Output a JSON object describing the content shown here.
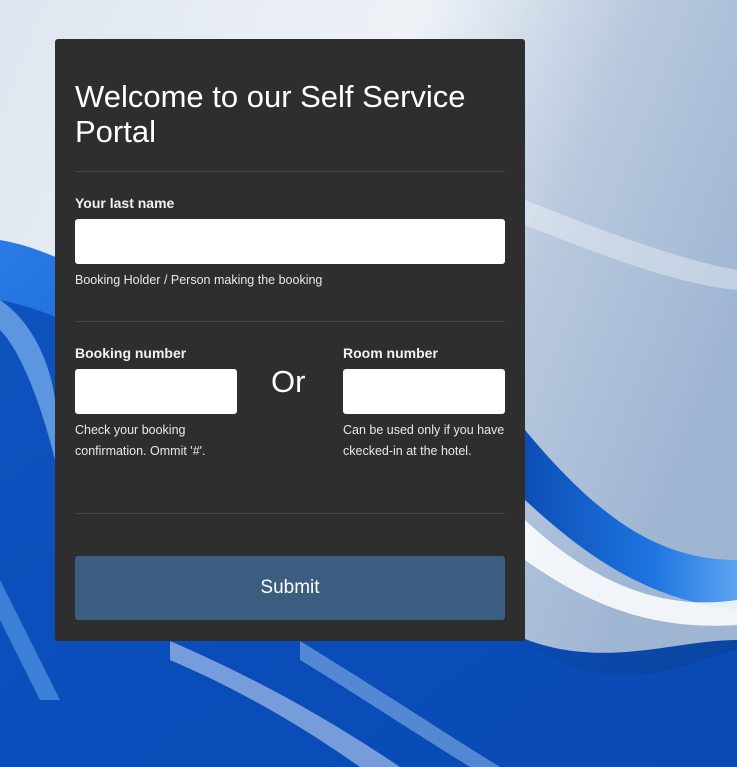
{
  "page": {
    "title": "Welcome to our Self Service Portal"
  },
  "last_name": {
    "label": "Your last name",
    "value": "",
    "help": "Booking Holder / Person making the booking"
  },
  "booking_number": {
    "label": "Booking number",
    "value": "",
    "help": "Check your booking confirmation. Ommit '#'."
  },
  "separator_text": "Or",
  "room_number": {
    "label": "Room number",
    "value": "",
    "help": "Can be used only if you have ckecked-in at the hotel."
  },
  "submit_label": "Submit",
  "colors": {
    "panel_bg": "#2e2e2e",
    "button_bg": "#3b5e80",
    "background_light": "#dfe6ef",
    "background_blue": "#0b5bd1"
  }
}
